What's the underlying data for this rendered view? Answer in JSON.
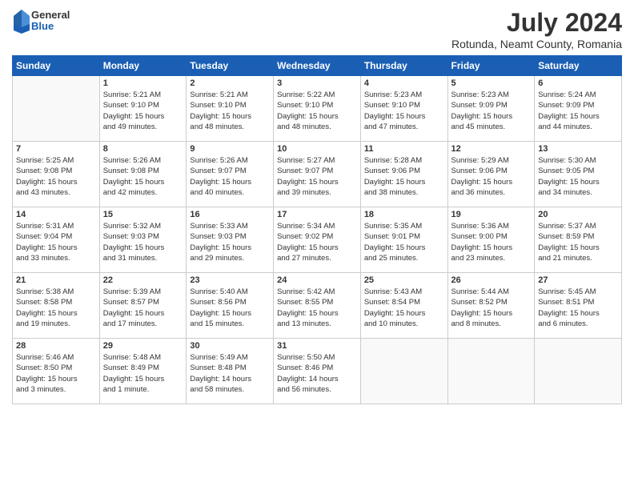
{
  "header": {
    "logo": {
      "general": "General",
      "blue": "Blue"
    },
    "title": "July 2024",
    "subtitle": "Rotunda, Neamt County, Romania"
  },
  "days_of_week": [
    "Sunday",
    "Monday",
    "Tuesday",
    "Wednesday",
    "Thursday",
    "Friday",
    "Saturday"
  ],
  "weeks": [
    [
      {
        "day": "",
        "info": ""
      },
      {
        "day": "1",
        "info": "Sunrise: 5:21 AM\nSunset: 9:10 PM\nDaylight: 15 hours\nand 49 minutes."
      },
      {
        "day": "2",
        "info": "Sunrise: 5:21 AM\nSunset: 9:10 PM\nDaylight: 15 hours\nand 48 minutes."
      },
      {
        "day": "3",
        "info": "Sunrise: 5:22 AM\nSunset: 9:10 PM\nDaylight: 15 hours\nand 48 minutes."
      },
      {
        "day": "4",
        "info": "Sunrise: 5:23 AM\nSunset: 9:10 PM\nDaylight: 15 hours\nand 47 minutes."
      },
      {
        "day": "5",
        "info": "Sunrise: 5:23 AM\nSunset: 9:09 PM\nDaylight: 15 hours\nand 45 minutes."
      },
      {
        "day": "6",
        "info": "Sunrise: 5:24 AM\nSunset: 9:09 PM\nDaylight: 15 hours\nand 44 minutes."
      }
    ],
    [
      {
        "day": "7",
        "info": "Sunrise: 5:25 AM\nSunset: 9:08 PM\nDaylight: 15 hours\nand 43 minutes."
      },
      {
        "day": "8",
        "info": "Sunrise: 5:26 AM\nSunset: 9:08 PM\nDaylight: 15 hours\nand 42 minutes."
      },
      {
        "day": "9",
        "info": "Sunrise: 5:26 AM\nSunset: 9:07 PM\nDaylight: 15 hours\nand 40 minutes."
      },
      {
        "day": "10",
        "info": "Sunrise: 5:27 AM\nSunset: 9:07 PM\nDaylight: 15 hours\nand 39 minutes."
      },
      {
        "day": "11",
        "info": "Sunrise: 5:28 AM\nSunset: 9:06 PM\nDaylight: 15 hours\nand 38 minutes."
      },
      {
        "day": "12",
        "info": "Sunrise: 5:29 AM\nSunset: 9:06 PM\nDaylight: 15 hours\nand 36 minutes."
      },
      {
        "day": "13",
        "info": "Sunrise: 5:30 AM\nSunset: 9:05 PM\nDaylight: 15 hours\nand 34 minutes."
      }
    ],
    [
      {
        "day": "14",
        "info": "Sunrise: 5:31 AM\nSunset: 9:04 PM\nDaylight: 15 hours\nand 33 minutes."
      },
      {
        "day": "15",
        "info": "Sunrise: 5:32 AM\nSunset: 9:03 PM\nDaylight: 15 hours\nand 31 minutes."
      },
      {
        "day": "16",
        "info": "Sunrise: 5:33 AM\nSunset: 9:03 PM\nDaylight: 15 hours\nand 29 minutes."
      },
      {
        "day": "17",
        "info": "Sunrise: 5:34 AM\nSunset: 9:02 PM\nDaylight: 15 hours\nand 27 minutes."
      },
      {
        "day": "18",
        "info": "Sunrise: 5:35 AM\nSunset: 9:01 PM\nDaylight: 15 hours\nand 25 minutes."
      },
      {
        "day": "19",
        "info": "Sunrise: 5:36 AM\nSunset: 9:00 PM\nDaylight: 15 hours\nand 23 minutes."
      },
      {
        "day": "20",
        "info": "Sunrise: 5:37 AM\nSunset: 8:59 PM\nDaylight: 15 hours\nand 21 minutes."
      }
    ],
    [
      {
        "day": "21",
        "info": "Sunrise: 5:38 AM\nSunset: 8:58 PM\nDaylight: 15 hours\nand 19 minutes."
      },
      {
        "day": "22",
        "info": "Sunrise: 5:39 AM\nSunset: 8:57 PM\nDaylight: 15 hours\nand 17 minutes."
      },
      {
        "day": "23",
        "info": "Sunrise: 5:40 AM\nSunset: 8:56 PM\nDaylight: 15 hours\nand 15 minutes."
      },
      {
        "day": "24",
        "info": "Sunrise: 5:42 AM\nSunset: 8:55 PM\nDaylight: 15 hours\nand 13 minutes."
      },
      {
        "day": "25",
        "info": "Sunrise: 5:43 AM\nSunset: 8:54 PM\nDaylight: 15 hours\nand 10 minutes."
      },
      {
        "day": "26",
        "info": "Sunrise: 5:44 AM\nSunset: 8:52 PM\nDaylight: 15 hours\nand 8 minutes."
      },
      {
        "day": "27",
        "info": "Sunrise: 5:45 AM\nSunset: 8:51 PM\nDaylight: 15 hours\nand 6 minutes."
      }
    ],
    [
      {
        "day": "28",
        "info": "Sunrise: 5:46 AM\nSunset: 8:50 PM\nDaylight: 15 hours\nand 3 minutes."
      },
      {
        "day": "29",
        "info": "Sunrise: 5:48 AM\nSunset: 8:49 PM\nDaylight: 15 hours\nand 1 minute."
      },
      {
        "day": "30",
        "info": "Sunrise: 5:49 AM\nSunset: 8:48 PM\nDaylight: 14 hours\nand 58 minutes."
      },
      {
        "day": "31",
        "info": "Sunrise: 5:50 AM\nSunset: 8:46 PM\nDaylight: 14 hours\nand 56 minutes."
      },
      {
        "day": "",
        "info": ""
      },
      {
        "day": "",
        "info": ""
      },
      {
        "day": "",
        "info": ""
      }
    ]
  ]
}
